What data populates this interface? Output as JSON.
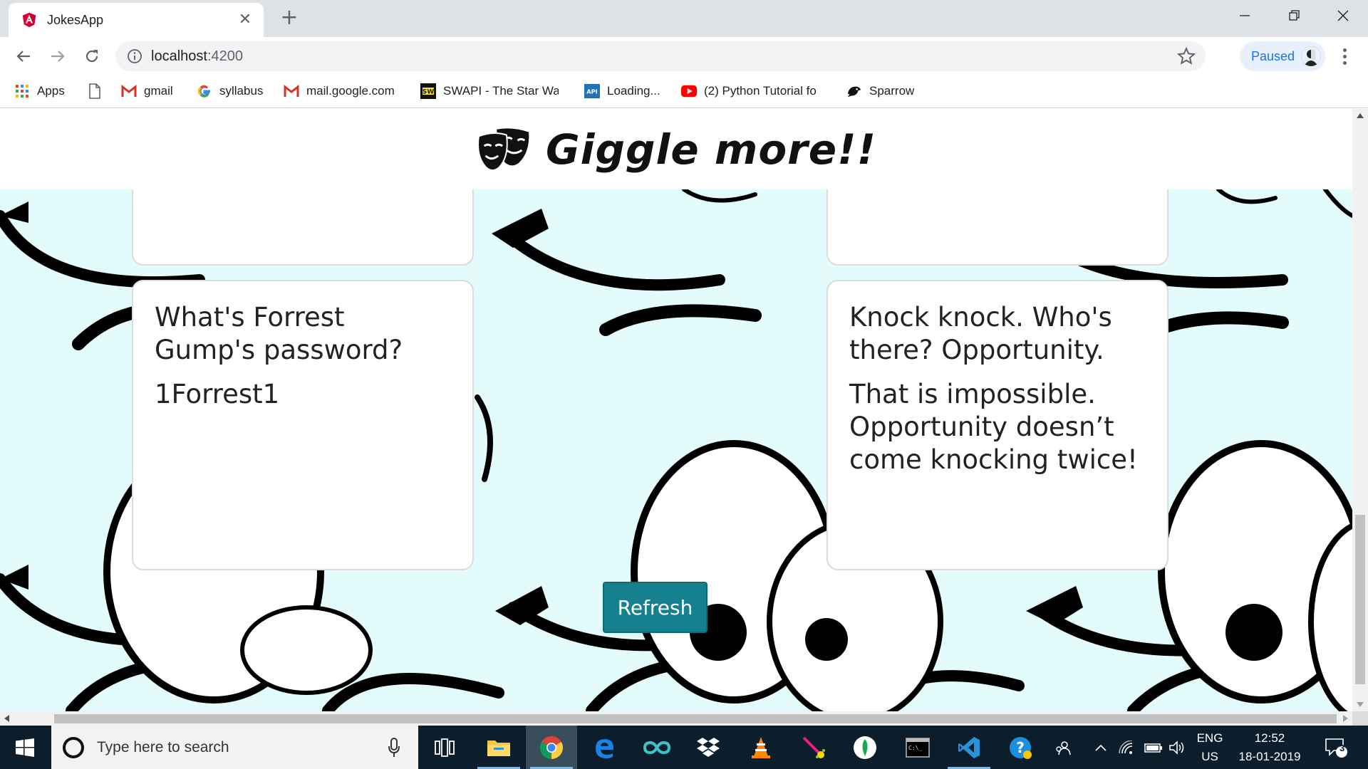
{
  "browser": {
    "tab": {
      "title": "JokesApp"
    },
    "address": {
      "host": "localhost",
      "port": ":4200"
    },
    "profile": {
      "status": "Paused"
    }
  },
  "bookmarks": [
    {
      "label": "Apps",
      "icon": "apps-grid-icon"
    },
    {
      "label": "",
      "icon": "page-icon"
    },
    {
      "label": "gmail",
      "icon": "gmail-icon"
    },
    {
      "label": "syllabus",
      "icon": "google-icon"
    },
    {
      "label": "mail.google.com",
      "icon": "gmail-icon"
    },
    {
      "label": "SWAPI - The Star War",
      "icon": "swapi-icon"
    },
    {
      "label": "Loading...",
      "icon": "api-icon"
    },
    {
      "label": "(2) Python Tutorial fo",
      "icon": "youtube-icon"
    },
    {
      "label": "Sparrow",
      "icon": "sparrow-icon"
    }
  ],
  "page": {
    "title": "Giggle more!!",
    "jokes": [
      {
        "question": "",
        "answer": ""
      },
      {
        "question": "",
        "answer": ""
      },
      {
        "question": "What's Forrest Gump's password?",
        "answer": "1Forrest1"
      },
      {
        "question": "Knock knock. Who's there? Opportunity.",
        "answer": "That is impossible. Opportunity doesn’t come knocking twice!"
      }
    ],
    "refresh_label": "Refresh"
  },
  "taskbar": {
    "search_placeholder": "Type here to search",
    "apps": [
      "task-view-icon",
      "file-explorer-icon",
      "chrome-icon",
      "edge-icon",
      "arduino-icon",
      "dropbox-icon",
      "vlc-icon",
      "cheat-icon",
      "mongodb-icon",
      "terminal-icon",
      "vscode-icon",
      "help-icon"
    ],
    "lang_top": "ENG",
    "lang_bottom": "US",
    "time": "12:52",
    "date": "18-01-2019",
    "notification_count": "3"
  },
  "colors": {
    "page_bg": "#e3fbfb",
    "refresh_bg": "#17808f",
    "accent": "#1a73e8"
  }
}
